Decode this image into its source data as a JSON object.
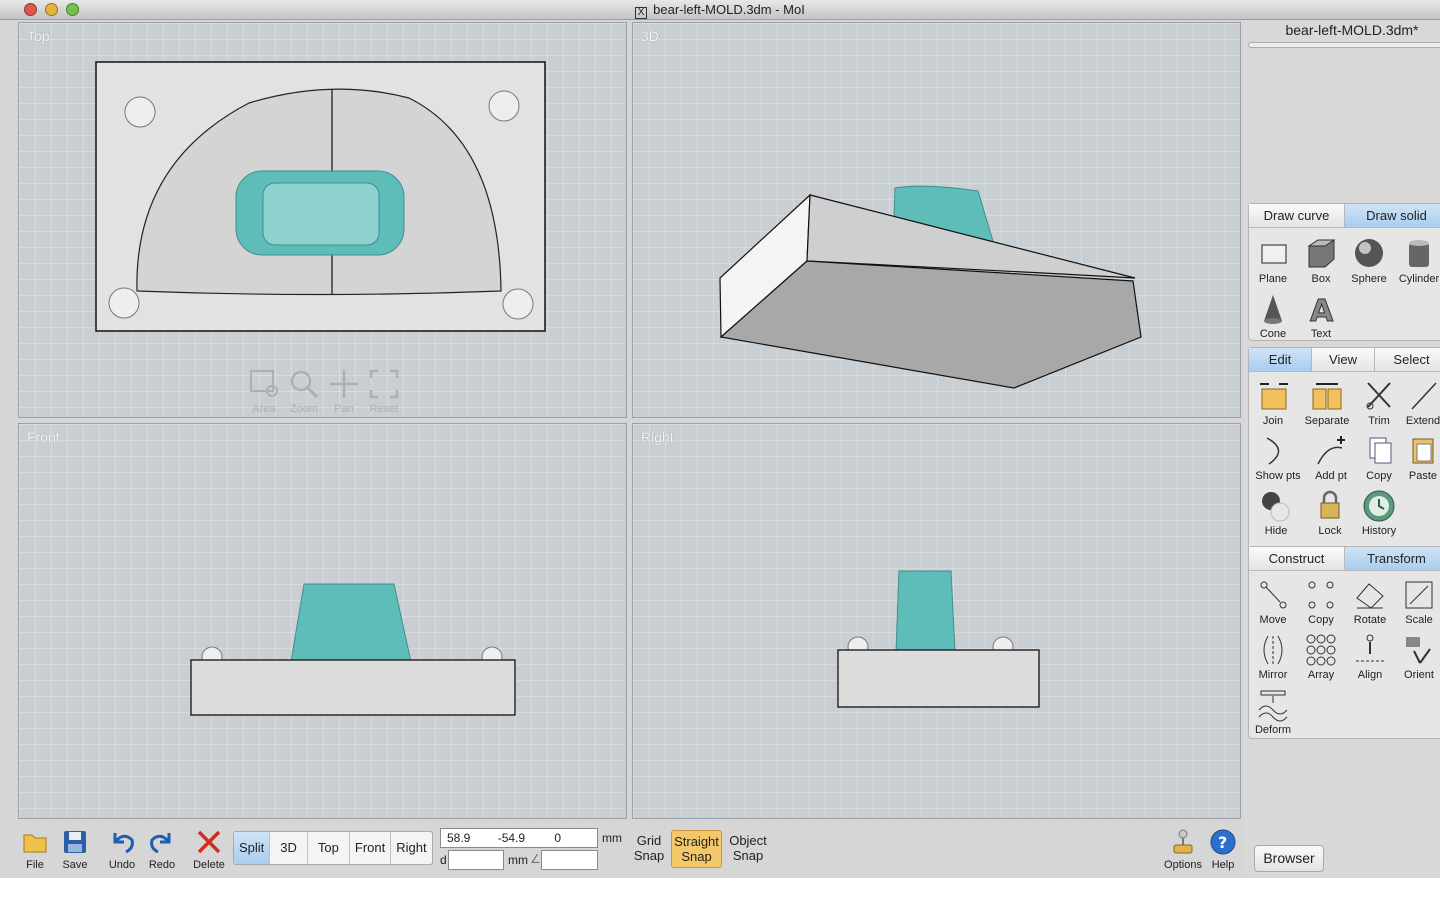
{
  "window": {
    "title": "bear-left-MOLD.3dm - MoI"
  },
  "viewports": {
    "top": {
      "label": "Top"
    },
    "perspective": {
      "label": "3D"
    },
    "front": {
      "label": "Front"
    },
    "right": {
      "label": "Right"
    }
  },
  "viewport_tools": [
    {
      "label": "Area",
      "icon": "area-zoom-icon"
    },
    {
      "label": "Zoom",
      "icon": "magnifier-icon"
    },
    {
      "label": "Pan",
      "icon": "pan-arrows-icon"
    },
    {
      "label": "Reset",
      "icon": "reset-view-icon"
    }
  ],
  "sidebar": {
    "file_label": "bear-left-MOLD.3dm*",
    "draw_panel": {
      "tabs": [
        "Draw curve",
        "Draw solid"
      ],
      "active_tab": "Draw solid",
      "tools": [
        {
          "label": "Plane",
          "icon": "plane-icon"
        },
        {
          "label": "Box",
          "icon": "box-icon"
        },
        {
          "label": "Sphere",
          "icon": "sphere-icon"
        },
        {
          "label": "Cylinder",
          "icon": "cylinder-icon"
        },
        {
          "label": "Cone",
          "icon": "cone-icon"
        },
        {
          "label": "Text",
          "icon": "text-icon"
        }
      ]
    },
    "edit_panel": {
      "tabs": [
        "Edit",
        "View",
        "Select"
      ],
      "active_tab": "Edit",
      "tools": [
        {
          "label": "Join",
          "icon": "join-icon"
        },
        {
          "label": "Separate",
          "icon": "separate-icon"
        },
        {
          "label": "Trim",
          "icon": "scissors-icon"
        },
        {
          "label": "Extend",
          "icon": "extend-icon"
        },
        {
          "label": "Show pts",
          "icon": "show-points-icon"
        },
        {
          "label": "Add pt",
          "icon": "add-point-icon"
        },
        {
          "label": "Copy",
          "icon": "copy-icon"
        },
        {
          "label": "Paste",
          "icon": "paste-icon"
        },
        {
          "label": "Hide",
          "icon": "hide-icon"
        },
        {
          "label": "Lock",
          "icon": "lock-icon"
        },
        {
          "label": "History",
          "icon": "history-icon"
        }
      ]
    },
    "transform_panel": {
      "tabs": [
        "Construct",
        "Transform"
      ],
      "active_tab": "Transform",
      "tools": [
        {
          "label": "Move",
          "icon": "move-icon"
        },
        {
          "label": "Copy",
          "icon": "copy-objects-icon"
        },
        {
          "label": "Rotate",
          "icon": "rotate-icon"
        },
        {
          "label": "Scale",
          "icon": "scale-icon"
        },
        {
          "label": "Mirror",
          "icon": "mirror-icon"
        },
        {
          "label": "Array",
          "icon": "array-icon"
        },
        {
          "label": "Align",
          "icon": "align-icon"
        },
        {
          "label": "Orient",
          "icon": "orient-icon"
        },
        {
          "label": "Deform",
          "icon": "deform-icon"
        }
      ]
    }
  },
  "bottombar": {
    "file": "File",
    "save": "Save",
    "undo": "Undo",
    "redo": "Redo",
    "delete": "Delete",
    "view_buttons": [
      "Split",
      "3D",
      "Top",
      "Front",
      "Right"
    ],
    "active_view": "Split",
    "coords": {
      "x": "58.9",
      "y": "-54.9",
      "z": "0",
      "unit": "mm"
    },
    "distance_prefix": "d",
    "distance_unit": "mm",
    "angle_symbol": "∠",
    "grid_snap": [
      "Grid",
      "Snap"
    ],
    "straight_snap": [
      "Straight",
      "Snap"
    ],
    "object_snap": [
      "Object",
      "Snap"
    ],
    "options": "Options",
    "help": "Help",
    "browser": "Browser"
  },
  "colors": {
    "active_tab": "#a9cdef",
    "straight_snap_on": "#f4c86a",
    "model_teal": "#5fbdb9",
    "viewport_bg": "#c9ced3"
  }
}
